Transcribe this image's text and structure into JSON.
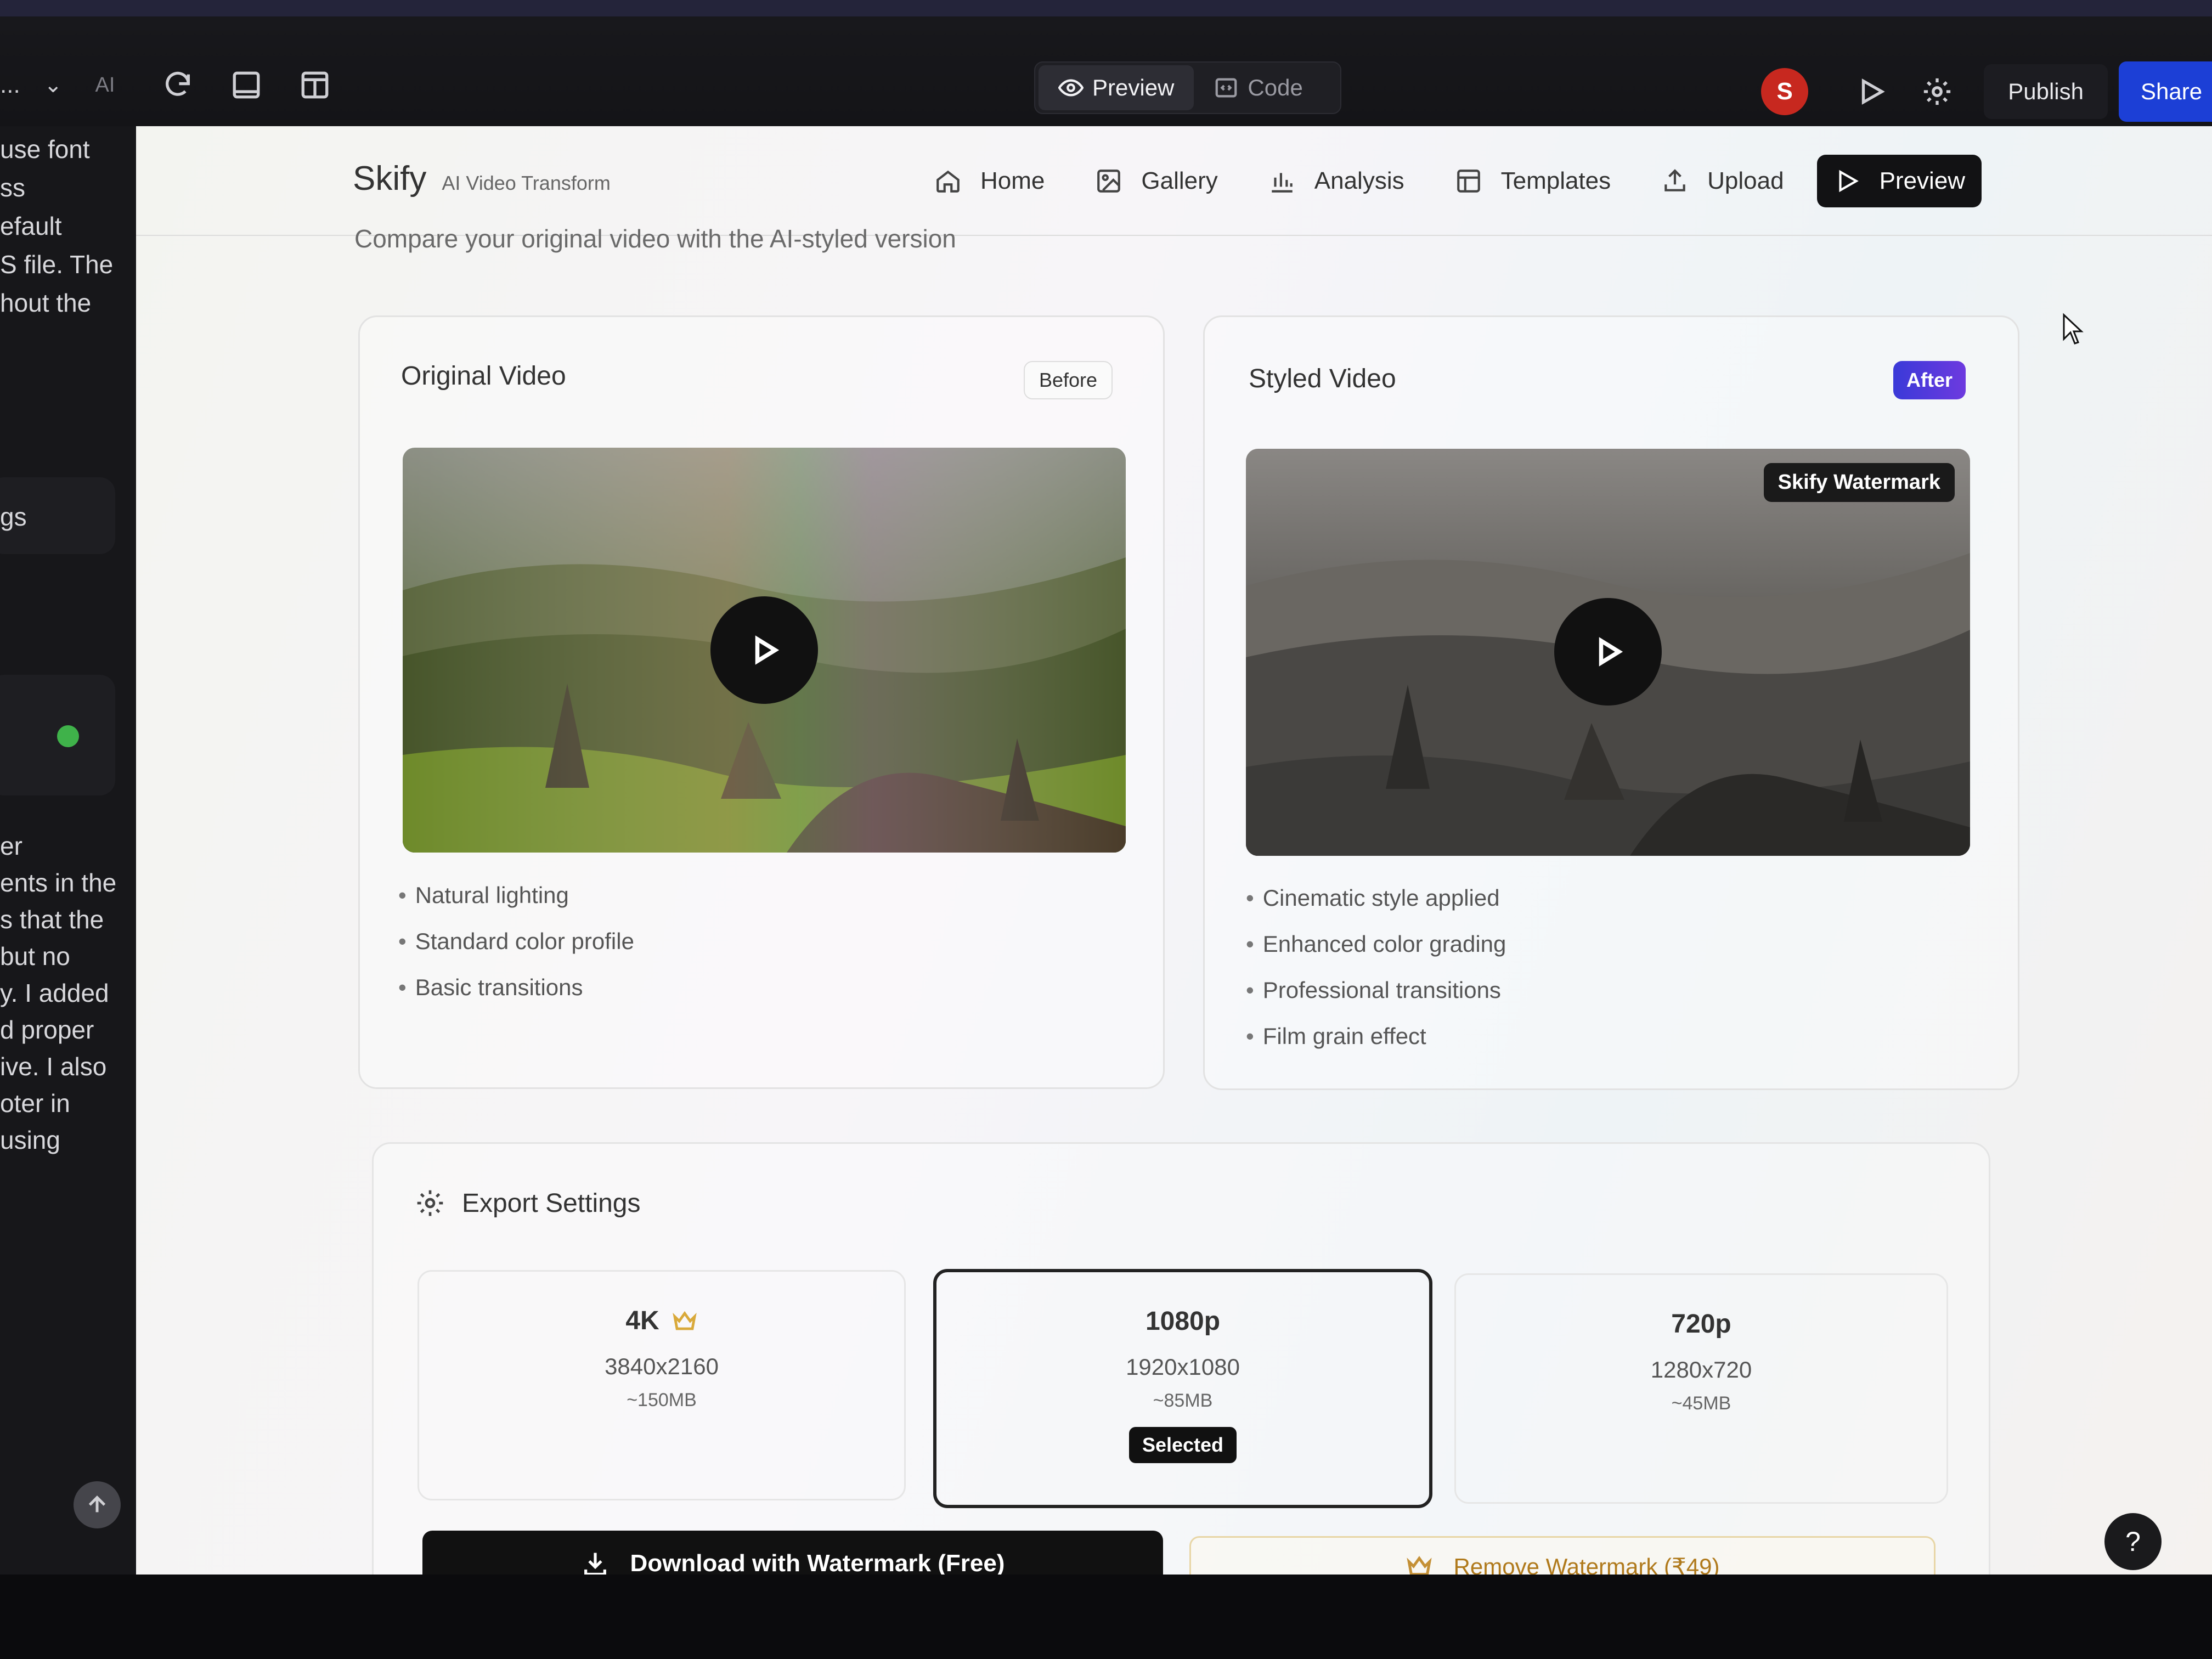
{
  "editor": {
    "toolbar_left": {
      "crumb": "...",
      "ai_label": "AI"
    },
    "view_toggle": [
      {
        "label": "Preview",
        "icon": "eye-icon",
        "active": true
      },
      {
        "label": "Code",
        "icon": "code-icon",
        "active": false
      }
    ],
    "avatar_initial": "S",
    "publish_label": "Publish",
    "share_label": "Share",
    "accent_color": "#1c3fd6"
  },
  "chat_panel": {
    "lines_top": [
      "use font",
      "ss",
      "efault",
      "S file. The",
      "hout the"
    ],
    "settings_fragment": "gs",
    "lines_bottom": [
      "er",
      "ents in the",
      "s that the",
      "but no",
      "y. I added",
      "d proper",
      "ive. I also",
      "oter in",
      "using"
    ]
  },
  "app": {
    "brand_name": "Skify",
    "brand_tagline": "AI Video Transform",
    "nav": [
      {
        "label": "Home",
        "icon": "home-icon"
      },
      {
        "label": "Gallery",
        "icon": "image-icon"
      },
      {
        "label": "Analysis",
        "icon": "bar-chart-icon"
      },
      {
        "label": "Templates",
        "icon": "layout-icon"
      },
      {
        "label": "Upload",
        "icon": "upload-icon"
      },
      {
        "label": "Preview",
        "icon": "play-icon",
        "active": true
      }
    ],
    "subtitle": "Compare your original video with the AI-styled version"
  },
  "original": {
    "title": "Original Video",
    "badge": "Before",
    "features": [
      "Natural lighting",
      "Standard color profile",
      "Basic transitions"
    ]
  },
  "styled": {
    "title": "Styled Video",
    "badge": "After",
    "watermark": "Skify Watermark",
    "features": [
      "Cinematic style applied",
      "Enhanced color grading",
      "Professional transitions",
      "Film grain effect"
    ],
    "badge_color": "#4b3ae0"
  },
  "export": {
    "title": "Export Settings",
    "options": [
      {
        "name": "4K",
        "dims": "3840x2160",
        "size": "~150MB",
        "premium": true,
        "selected": false
      },
      {
        "name": "1080p",
        "dims": "1920x1080",
        "size": "~85MB",
        "premium": false,
        "selected": true,
        "selected_label": "Selected"
      },
      {
        "name": "720p",
        "dims": "1280x720",
        "size": "~45MB",
        "premium": false,
        "selected": false
      }
    ],
    "download_label": "Download with Watermark (Free)",
    "remove_label": "Remove Watermark (₹49)"
  },
  "help_label": "?"
}
